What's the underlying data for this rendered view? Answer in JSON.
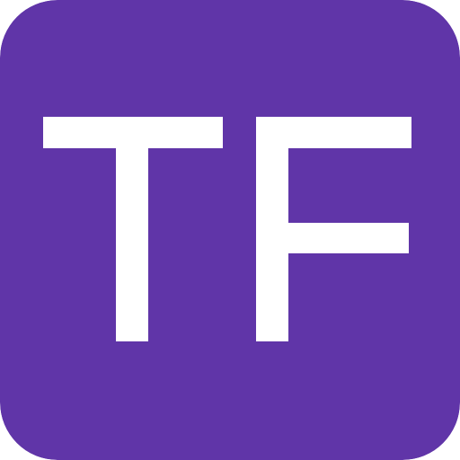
{
  "icon": {
    "name": "TF app icon",
    "monogram": "TF",
    "background_color": "#6035A8",
    "foreground_color": "#FFFFFF"
  }
}
